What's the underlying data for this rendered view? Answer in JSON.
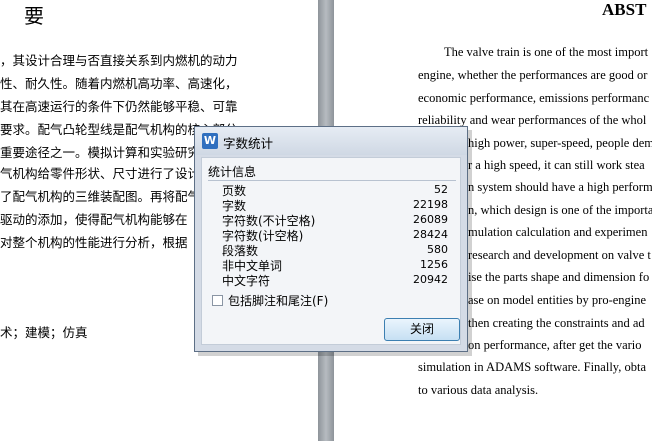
{
  "left_page": {
    "heading": "要",
    "lines": [
      "，其设计合理与否直接关系到内燃机的动力",
      "性、耐久性。随着内燃机高功率、高速化，",
      "其在高速运行的条件下仍然能够平稳、可靠",
      "要求。配气凸轮型线是配气机构的核心部分，",
      "重要途径之一。模拟计算和实验研究",
      "气机构给零件形状、尺寸进行了设计",
      "了配气机构的三维装配图。再将配气",
      "驱动的添加，使得配气机构能够在",
      "对整个机构的性能进行分析，根据",
      "术；建模；仿真"
    ]
  },
  "right_page": {
    "heading": "ABST",
    "lines": [
      "The valve train is one of the most import",
      "engine, whether the performances are good or",
      "economic performance, emissions performanc",
      "reliability and wear performances of the whol",
      "high power, super-speed, people dem",
      "r a high speed, it can still work stea",
      "n system should have a high perform",
      "n, which design is one of the importa",
      "mulation calculation and experimen",
      "research and development on valve t",
      "ise the parts shape and dimension fo",
      "ase on model entities by pro-engine",
      "then creating the constraints and ad",
      "on performance, after get the vario",
      "simulation in ADAMS software. Finally, obta",
      "to various data analysis."
    ]
  },
  "dialog": {
    "app_icon_glyph": "W",
    "title": "字数统计",
    "group_label": "统计信息",
    "stats": [
      {
        "label": "页数",
        "value": "52"
      },
      {
        "label": "字数",
        "value": "22198"
      },
      {
        "label": "字符数(不计空格)",
        "value": "26089"
      },
      {
        "label": "字符数(计空格)",
        "value": "28424"
      },
      {
        "label": "段落数",
        "value": "580"
      },
      {
        "label": "非中文单词",
        "value": "1256"
      },
      {
        "label": "中文字符",
        "value": "20942"
      }
    ],
    "checkbox_label": "包括脚注和尾注(F)",
    "checkbox_checked": false,
    "close_label": "关闭"
  }
}
